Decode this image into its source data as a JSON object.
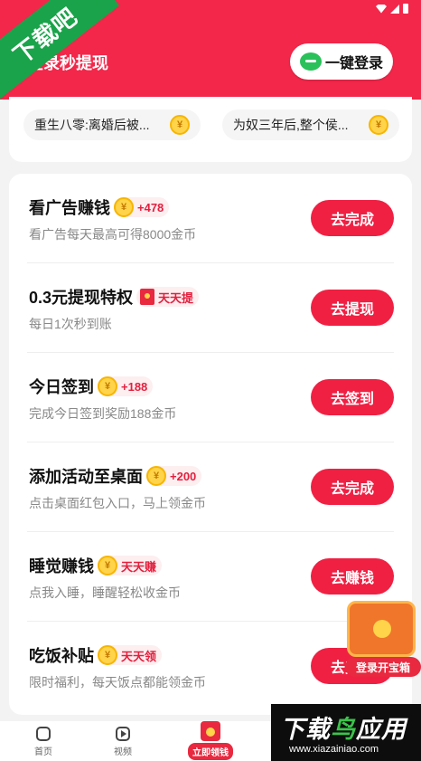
{
  "header": {
    "title": "登录秒提现",
    "login_button": "一键登录"
  },
  "novels": [
    {
      "title": "重生八零:离婚后被..."
    },
    {
      "title": "为奴三年后,整个侯..."
    }
  ],
  "tasks": [
    {
      "title": "看广告赚钱",
      "reward": "+478",
      "desc": "看广告每天最高可得8000金币",
      "button": "去完成"
    },
    {
      "title": "0.3元提现特权",
      "reward": "天天提",
      "desc": "每日1次秒到账",
      "button": "去提现"
    },
    {
      "title": "今日签到",
      "reward": "+188",
      "desc": "完成今日签到奖励188金币",
      "button": "去签到"
    },
    {
      "title": "添加活动至桌面",
      "reward": "+200",
      "desc": "点击桌面红包入口，马上领金币",
      "button": "去完成"
    },
    {
      "title": "睡觉赚钱",
      "reward": "天天赚",
      "desc": "点我入睡，睡醒轻松收金币",
      "button": "去赚钱"
    },
    {
      "title": "吃饭补贴",
      "reward": "天天领",
      "desc": "限时福利，每天饭点都能领金币",
      "button": "去完成"
    }
  ],
  "treasure": {
    "label": "登录开宝箱"
  },
  "bottom_nav": {
    "home": "首页",
    "video": "视频",
    "center": "立即领钱"
  },
  "watermarks": {
    "top_left": "下载吧",
    "bottom_right_a": "下载",
    "bottom_right_b": "鸟",
    "bottom_right_c": "应用",
    "url": "www.xiazainiao.com"
  },
  "colors": {
    "brand_red": "#f2274a",
    "button_red": "#f02043",
    "coin_gold": "#ffd34a",
    "background": "#f3f3f3"
  }
}
